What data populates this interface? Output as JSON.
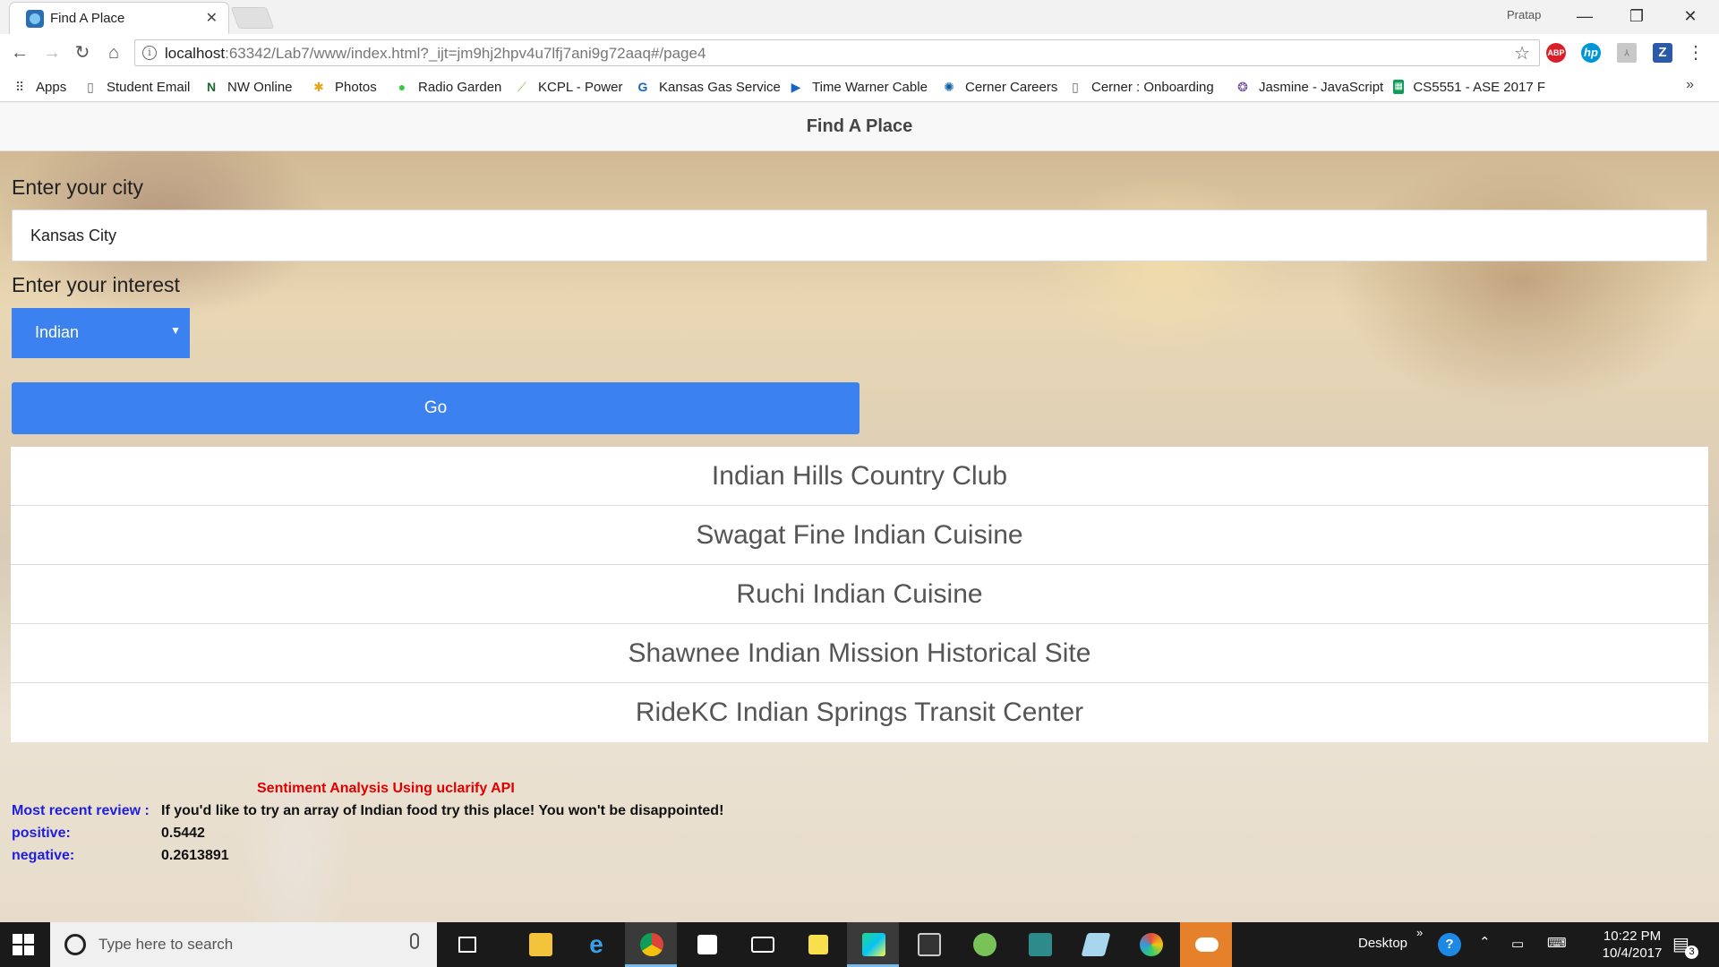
{
  "browser": {
    "tab_title": "Find A Place",
    "profile": "Pratap",
    "url_host": "localhost",
    "url_rest": ":63342/Lab7/www/index.html?_ijt=jm9hj2hpv4u7lfj7ani9g72aaq#/page4",
    "bookmarks": [
      "Apps",
      "Student Email",
      "NW Online",
      "Photos",
      "Radio Garden",
      "KCPL - Power",
      "Kansas Gas Service",
      "Time Warner Cable",
      "Cerner Careers",
      "Cerner : Onboarding",
      "Jasmine - JavaScript",
      "CS5551 - ASE 2017 F"
    ],
    "extensions": [
      "ABP",
      "hp",
      "Z"
    ]
  },
  "app": {
    "header_title": "Find A Place",
    "city_label": "Enter your city",
    "city_value": "Kansas City",
    "interest_label": "Enter your interest",
    "interest_value": "Indian",
    "go_label": "Go",
    "results": [
      "Indian Hills Country Club",
      "Swagat Fine Indian Cuisine",
      "Ruchi Indian Cuisine",
      "Shawnee Indian Mission Historical Site",
      "RideKC Indian Springs Transit Center"
    ],
    "sentiment": {
      "title": "Sentiment Analysis Using uclarify API",
      "review_label": "Most recent review :",
      "review_text": "If you'd like to try an array of Indian food try this place! You won't be disappointed!",
      "positive_label": "positive:",
      "positive_value": "0.5442",
      "negative_label": "negative:",
      "negative_value": "0.2613891"
    }
  },
  "taskbar": {
    "search_placeholder": "Type here to search",
    "desktop_label": "Desktop",
    "time": "10:22 PM",
    "date": "10/4/2017",
    "notification_count": "3"
  },
  "colors": {
    "accent": "#3b82f0",
    "sentiment_title": "#e00000",
    "sentiment_label": "#1e1edc"
  }
}
